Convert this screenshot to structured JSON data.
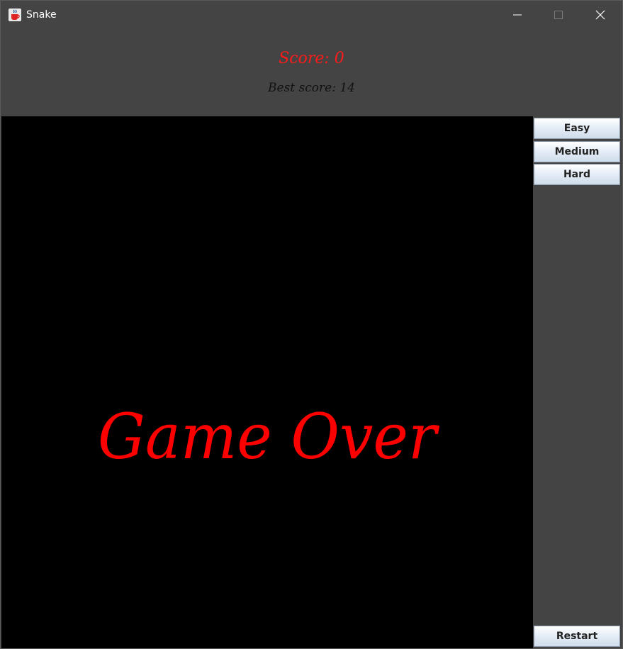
{
  "window": {
    "title": "Snake",
    "icons": {
      "app": "java-cup-icon",
      "minimize": "minimize-icon",
      "maximize": "maximize-icon",
      "close": "close-icon"
    }
  },
  "header": {
    "score_text": "Score: 0",
    "best_score_text": "Best score: 14"
  },
  "game": {
    "message": "Game Over",
    "message_color": "#ff0000",
    "board_color": "#000000"
  },
  "side_panel": {
    "buttons": {
      "easy": "Easy",
      "medium": "Medium",
      "hard": "Hard",
      "restart": "Restart"
    }
  },
  "colors": {
    "score": "#ff1a1a",
    "best_score": "#111111",
    "panel_bg": "#444444"
  }
}
